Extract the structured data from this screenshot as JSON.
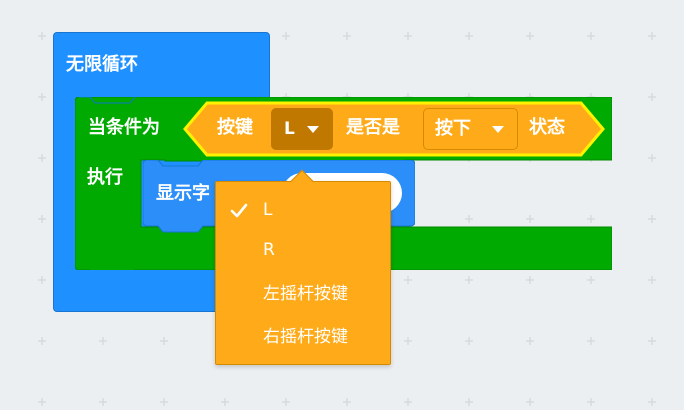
{
  "colors": {
    "workspace_bg": "#eceff1",
    "grid_plus": "#d5d9dc",
    "forever_blue": "#1e90ff",
    "while_green": "#00aa00",
    "condition_orange": "#ffab19",
    "condition_border": "#fff200",
    "dropdown_dark": "#c07800",
    "display_blue": "#2c8ef8"
  },
  "forever_block": {
    "label": "无限循环"
  },
  "while_block": {
    "label": "当条件为",
    "do_label": "执行"
  },
  "condition_block": {
    "prefix": "按键",
    "key_value": "L",
    "middle": "是否是",
    "state_value": "按下",
    "suffix": "状态"
  },
  "display_block": {
    "label": "显示字"
  },
  "dropdown_menu": {
    "items": [
      {
        "label": "L",
        "selected": true,
        "icon": "check-icon"
      },
      {
        "label": "R",
        "selected": false
      },
      {
        "label": "左摇杆按键",
        "selected": false
      },
      {
        "label": "右摇杆按键",
        "selected": false
      }
    ]
  }
}
